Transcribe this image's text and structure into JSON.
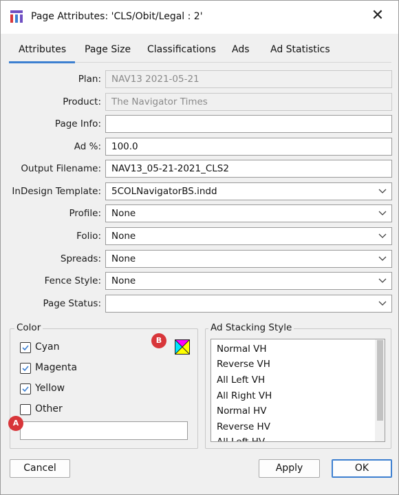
{
  "window": {
    "title": "Page Attributes: 'CLS/Obit/Legal : 2'",
    "close_glyph": "✕"
  },
  "tabs": [
    {
      "label": "Attributes",
      "selected": true
    },
    {
      "label": "Page Size",
      "selected": false
    },
    {
      "label": "Classifications",
      "selected": false
    },
    {
      "label": "Ads",
      "selected": false
    },
    {
      "label": "Ad Statistics",
      "selected": false
    }
  ],
  "form": {
    "plan": {
      "label": "Plan:",
      "value": "NAV13 2021-05-21"
    },
    "product": {
      "label": "Product:",
      "value": "The Navigator Times"
    },
    "page_info": {
      "label": "Page Info:",
      "value": ""
    },
    "ad_pct": {
      "label": "Ad %:",
      "value": "100.0"
    },
    "output_filename": {
      "label": "Output Filename:",
      "value": "NAV13_05-21-2021_CLS2"
    },
    "indesign_template": {
      "label": "InDesign Template:",
      "value": "5COLNavigatorBS.indd"
    },
    "profile": {
      "label": "Profile:",
      "value": "None"
    },
    "folio": {
      "label": "Folio:",
      "value": "None"
    },
    "spreads": {
      "label": "Spreads:",
      "value": "None"
    },
    "fence_style": {
      "label": "Fence Style:",
      "value": "None"
    },
    "page_status": {
      "label": "Page Status:",
      "value": ""
    }
  },
  "color_group": {
    "label": "Color",
    "checkboxes": [
      {
        "label": "Cyan",
        "checked": true
      },
      {
        "label": "Magenta",
        "checked": true
      },
      {
        "label": "Yellow",
        "checked": true
      },
      {
        "label": "Other",
        "checked": false
      }
    ],
    "other_value": "",
    "badge_a": "A",
    "badge_b": "B"
  },
  "ad_stacking": {
    "label": "Ad Stacking Style",
    "items": [
      "Normal VH",
      "Reverse VH",
      "All Left VH",
      "All Right VH",
      "Normal HV",
      "Reverse HV",
      "All Left HV"
    ]
  },
  "buttons": {
    "cancel": "Cancel",
    "apply": "Apply",
    "ok": "OK"
  },
  "colors": {
    "accent": "#3c7fd0",
    "badge": "#d8363a",
    "app_icon": "#6f4fc2"
  }
}
